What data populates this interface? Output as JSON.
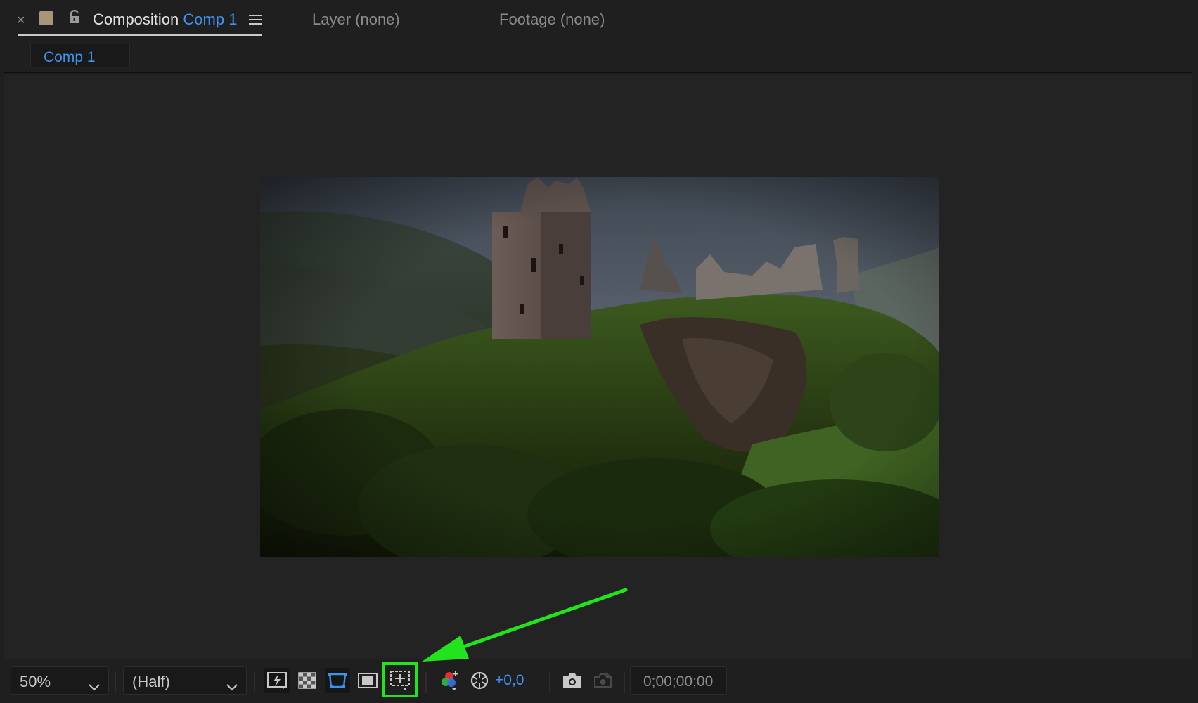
{
  "tabs": {
    "composition_prefix": "Composition",
    "composition_name": "Comp 1",
    "layer_label": "Layer (none)",
    "footage_label": "Footage (none)"
  },
  "breadcrumb": {
    "current": "Comp 1"
  },
  "toolbar": {
    "zoom": "50%",
    "resolution": "(Half)",
    "exposure": "+0,0",
    "timecode": "0;00;00;00",
    "icons": [
      "fast-previews-icon",
      "transparency-grid-icon",
      "mask-path-visibility-icon",
      "region-of-interest-icon",
      "grid-guides-icon",
      "show-channel-icon",
      "reset-exposure-icon",
      "snapshot-camera-icon",
      "show-snapshot-icon"
    ]
  },
  "colors": {
    "accent_blue": "#3d92ee",
    "highlight_green": "#22e41d",
    "panel_bg": "#1f1f1f",
    "viewer_bg": "#232323"
  }
}
